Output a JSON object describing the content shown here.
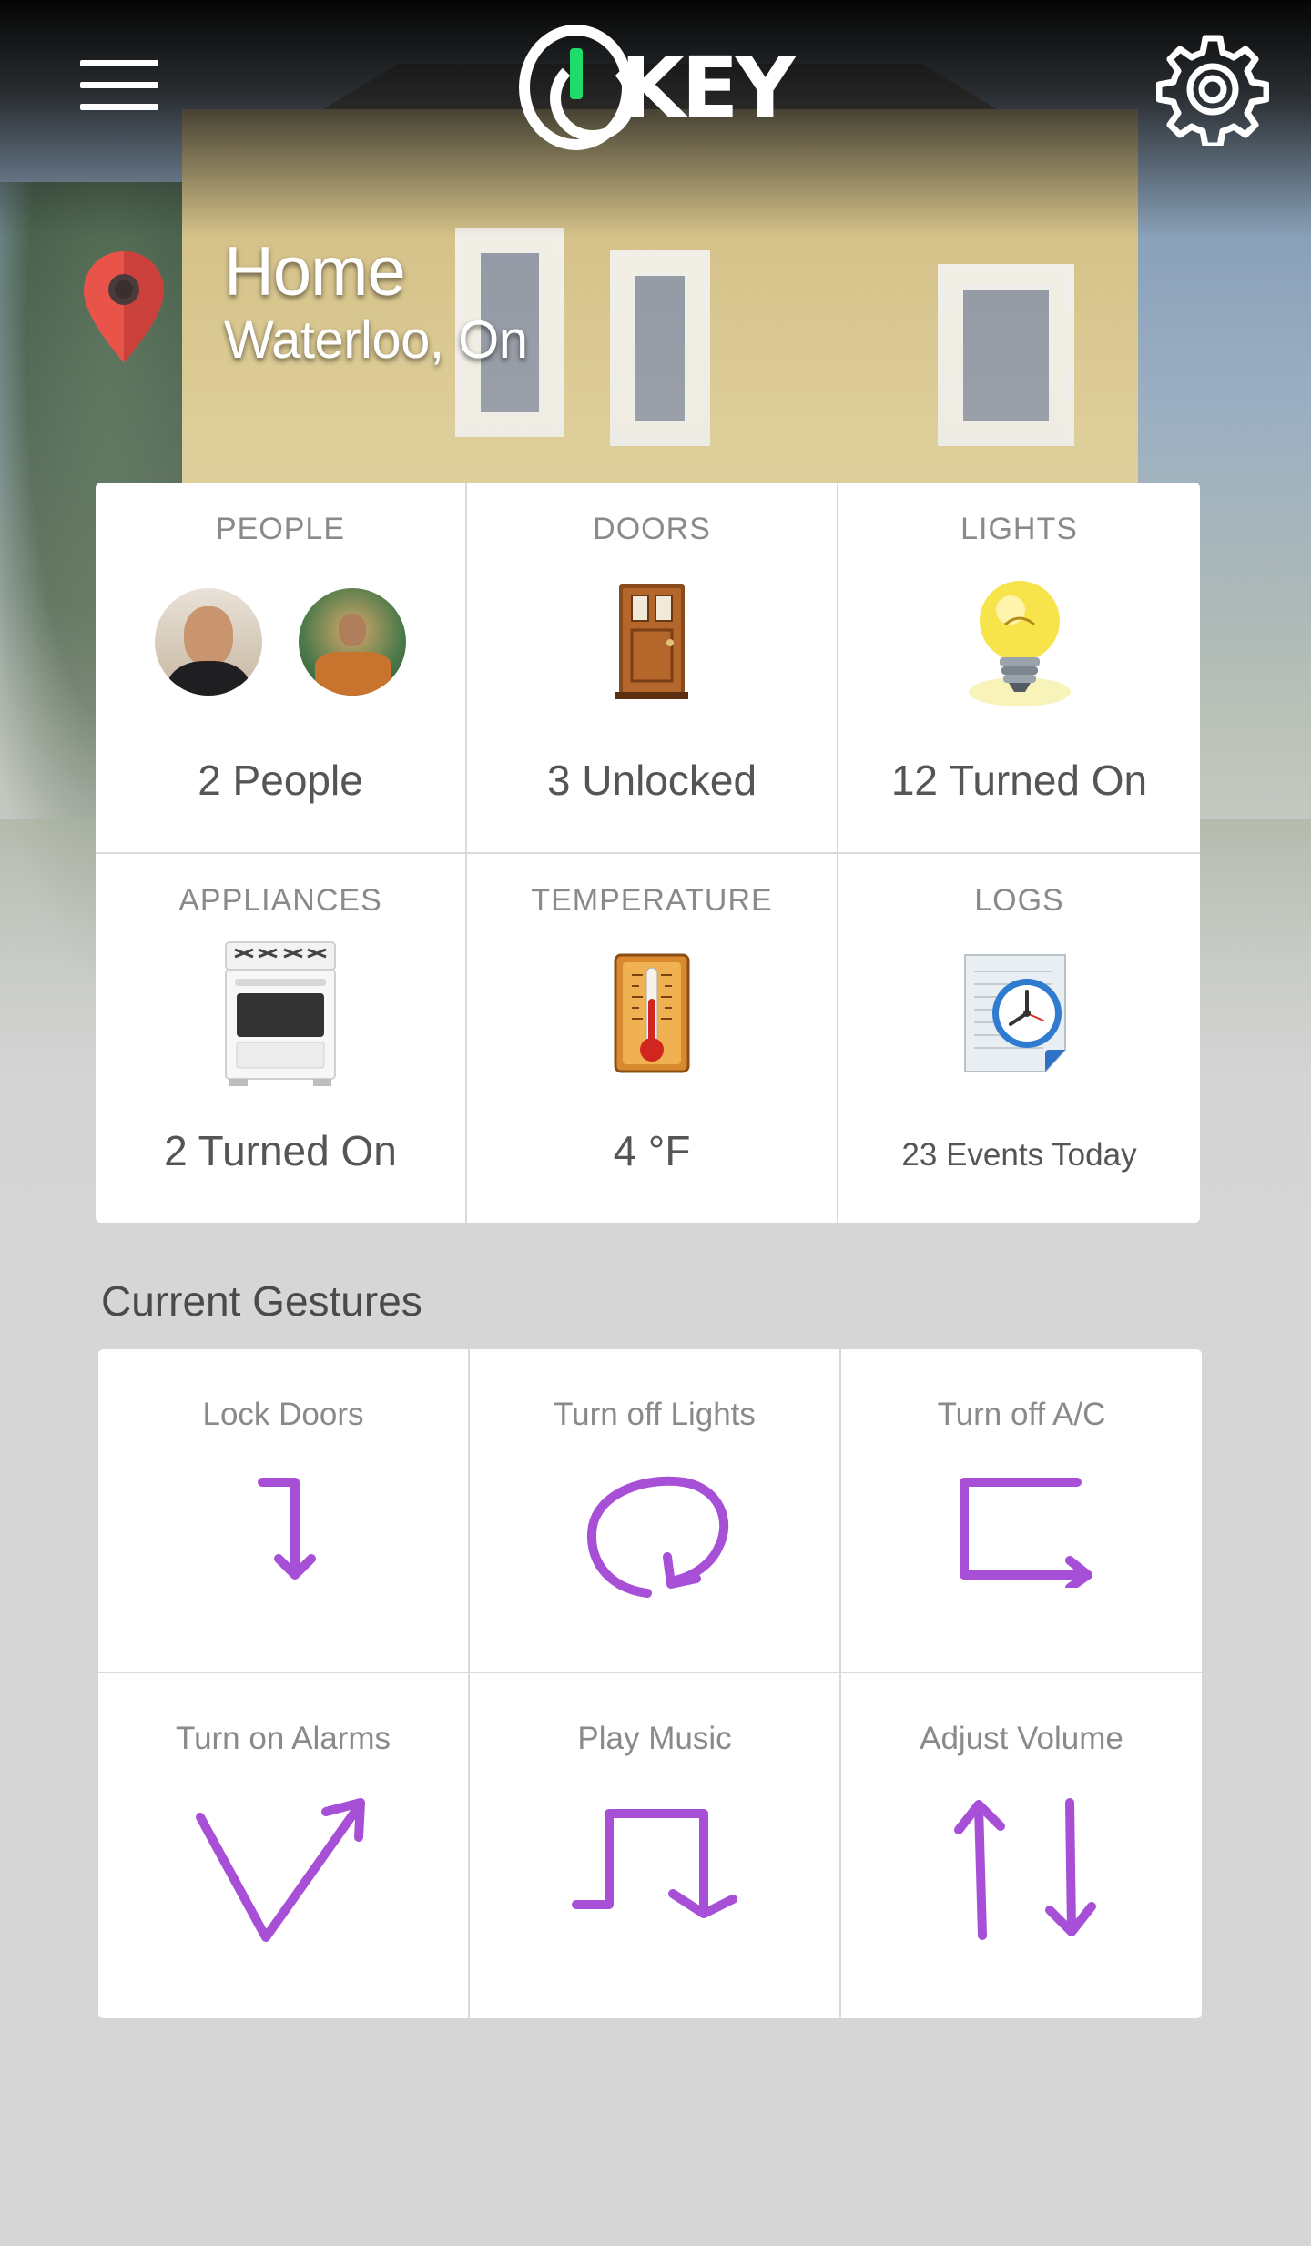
{
  "app": {
    "logo_text": "KEY"
  },
  "header": {
    "menu_icon": "hamburger-menu-icon",
    "settings_icon": "gear-icon",
    "accent_color": "#1ddc6a"
  },
  "location": {
    "pin_icon": "map-pin-icon",
    "title": "Home",
    "subtitle": "Waterloo, On",
    "pin_color": "#e8544a"
  },
  "status": {
    "people": {
      "title": "PEOPLE",
      "value": "2 People",
      "icon": "user-avatars"
    },
    "doors": {
      "title": "DOORS",
      "value": "3 Unlocked",
      "icon": "door-icon"
    },
    "lights": {
      "title": "LIGHTS",
      "value": "12 Turned On",
      "icon": "lightbulb-icon"
    },
    "appliances": {
      "title": "APPLIANCES",
      "value": "2 Turned On",
      "icon": "stove-icon"
    },
    "temperature": {
      "title": "TEMPERATURE",
      "value": "4 °F",
      "icon": "thermometer-icon"
    },
    "logs": {
      "title": "LOGS",
      "value": "23 Events Today",
      "icon": "clock-document-icon"
    }
  },
  "gestures": {
    "heading": "Current Gestures",
    "stroke_color": "#a74fd6",
    "items": [
      {
        "label": "Lock Doors",
        "icon": "gesture-hook-down-icon"
      },
      {
        "label": "Turn off Lights",
        "icon": "gesture-circle-icon"
      },
      {
        "label": "Turn off A/C",
        "icon": "gesture-bracket-right-icon"
      },
      {
        "label": "Turn on Alarms",
        "icon": "gesture-check-up-icon"
      },
      {
        "label": "Play Music",
        "icon": "gesture-square-wave-icon"
      },
      {
        "label": "Adjust Volume",
        "icon": "gesture-up-down-arrows-icon"
      }
    ]
  }
}
